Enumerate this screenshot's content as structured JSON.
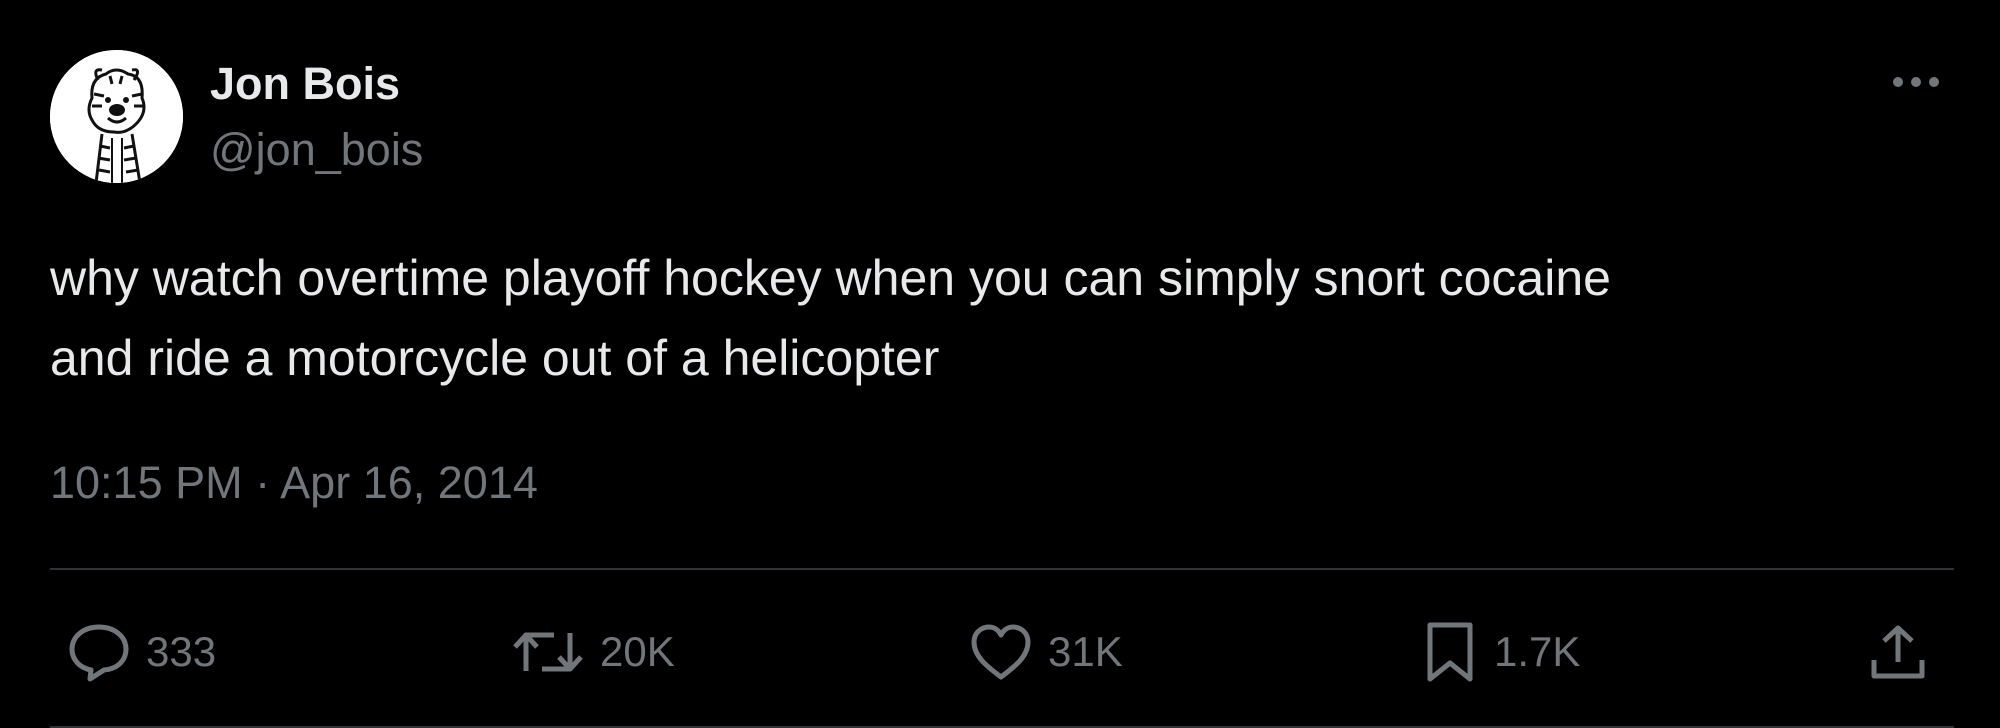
{
  "tweet": {
    "author": {
      "display_name": "Jon Bois",
      "handle": "@jon_bois",
      "avatar_icon": "calvin-and-hobbes-tiger-avatar"
    },
    "text": "why watch overtime playoff hockey when you can simply snort cocaine\nand ride a motorcycle out of a helicopter",
    "time": "10:15 PM",
    "separator": "·",
    "date": "Apr 16, 2014",
    "more_icon": "more-horizontal-icon"
  },
  "actions": {
    "reply": {
      "icon": "reply-icon",
      "count": "333"
    },
    "retweet": {
      "icon": "retweet-icon",
      "count": "20K"
    },
    "like": {
      "icon": "heart-icon",
      "count": "31K"
    },
    "bookmark": {
      "icon": "bookmark-icon",
      "count": "1.7K"
    },
    "share": {
      "icon": "share-icon"
    }
  },
  "colors": {
    "background": "#000000",
    "primary_text": "#e7e9ea",
    "secondary_text": "#71767b",
    "divider": "#2f3336"
  }
}
